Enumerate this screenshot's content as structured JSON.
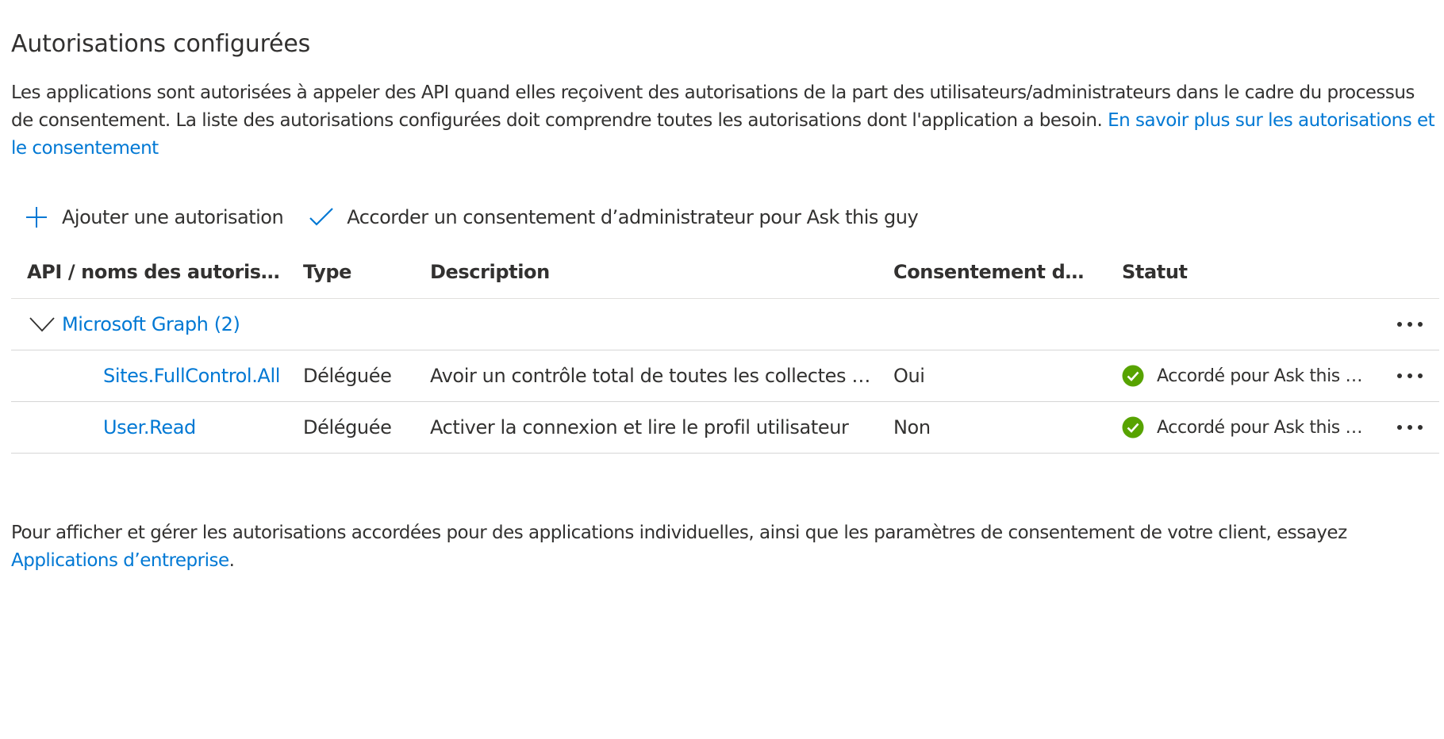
{
  "section": {
    "title": "Autorisations configurées",
    "intro_text": "Les applications sont autorisées à appeler des API quand elles reçoivent des autorisations de la part des utilisateurs/administrateurs dans le cadre du processus de consentement. La liste des autorisations configurées doit comprendre toutes les autorisations dont l'application a besoin. ",
    "intro_link": "En savoir plus sur les autorisations et le consentement"
  },
  "toolbar": {
    "add_label": "Ajouter une autorisation",
    "grant_label": "Accorder un consentement d’administrateur pour Ask this guy",
    "add_icon": "plus-icon",
    "grant_icon": "checkmark-icon"
  },
  "table": {
    "headers": {
      "api": "API / noms des autorisations",
      "type": "Type",
      "description": "Description",
      "consent": "Consentement de l'administrateur requis",
      "status": "Statut"
    },
    "group": {
      "label": "Microsoft Graph (2)"
    },
    "rows": [
      {
        "name": "Sites.FullControl.All",
        "type": "Déléguée",
        "description": "Avoir un contrôle total de toutes les collectes de sites",
        "consent": "Oui",
        "status": "Accordé pour Ask this guy"
      },
      {
        "name": "User.Read",
        "type": "Déléguée",
        "description": "Activer la connexion et lire le profil utilisateur",
        "consent": "Non",
        "status": "Accordé pour Ask this guy"
      }
    ]
  },
  "footer": {
    "text": "Pour afficher et gérer les autorisations accordées pour des applications individuelles, ainsi que les paramètres de consentement de votre client, essayez ",
    "link": "Applications d’entreprise",
    "suffix": "."
  },
  "colors": {
    "link": "#0078d4",
    "success": "#57a300",
    "text": "#323130",
    "divider": "#d6d6d6"
  }
}
